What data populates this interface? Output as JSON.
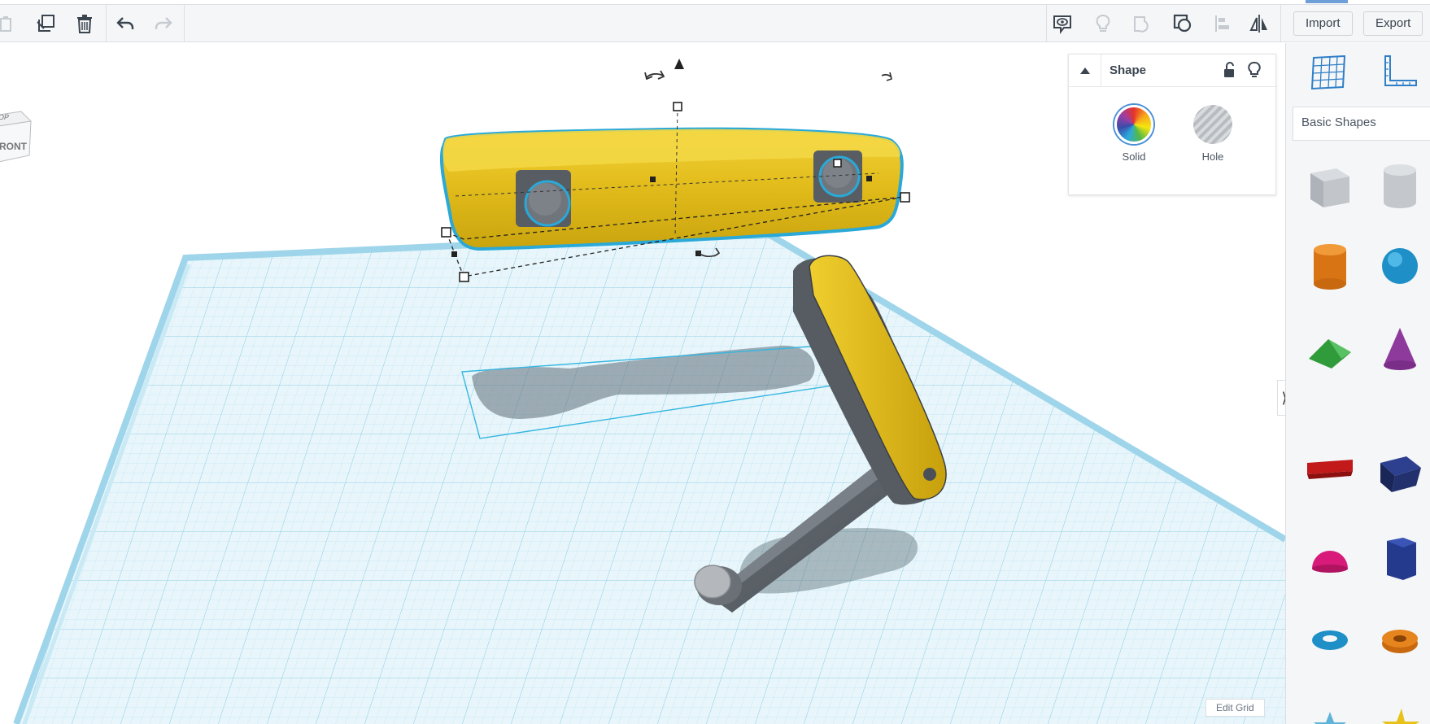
{
  "toolbar": {
    "left_icons": [
      "paste-icon",
      "duplicate-icon",
      "trash-icon",
      "undo-icon",
      "redo-icon"
    ],
    "right_icons": [
      "note-icon",
      "light-bulb-icon",
      "group-icon",
      "ungroup-icon",
      "align-icon",
      "mirror-icon"
    ],
    "import_label": "Import",
    "export_label": "Export"
  },
  "viewcube": {
    "front_label": "RONT",
    "top_label": "OP"
  },
  "shape_panel": {
    "title": "Shape",
    "solid_label": "Solid",
    "hole_label": "Hole"
  },
  "sidebar": {
    "category_label": "Basic Shapes",
    "shapes": [
      "box",
      "cylinder-hole",
      "cylinder",
      "sphere",
      "roof",
      "cone",
      "text",
      "wedge",
      "half-sphere",
      "polygon",
      "torus",
      "tube",
      "star",
      "star-gold"
    ]
  },
  "edit_grid_label": "Edit Grid",
  "colors": {
    "accent": "#6f9fd8",
    "grid_blue": "#bfe4f2",
    "yellow": "#f0ce2e",
    "dark_gray": "#5a6066"
  }
}
